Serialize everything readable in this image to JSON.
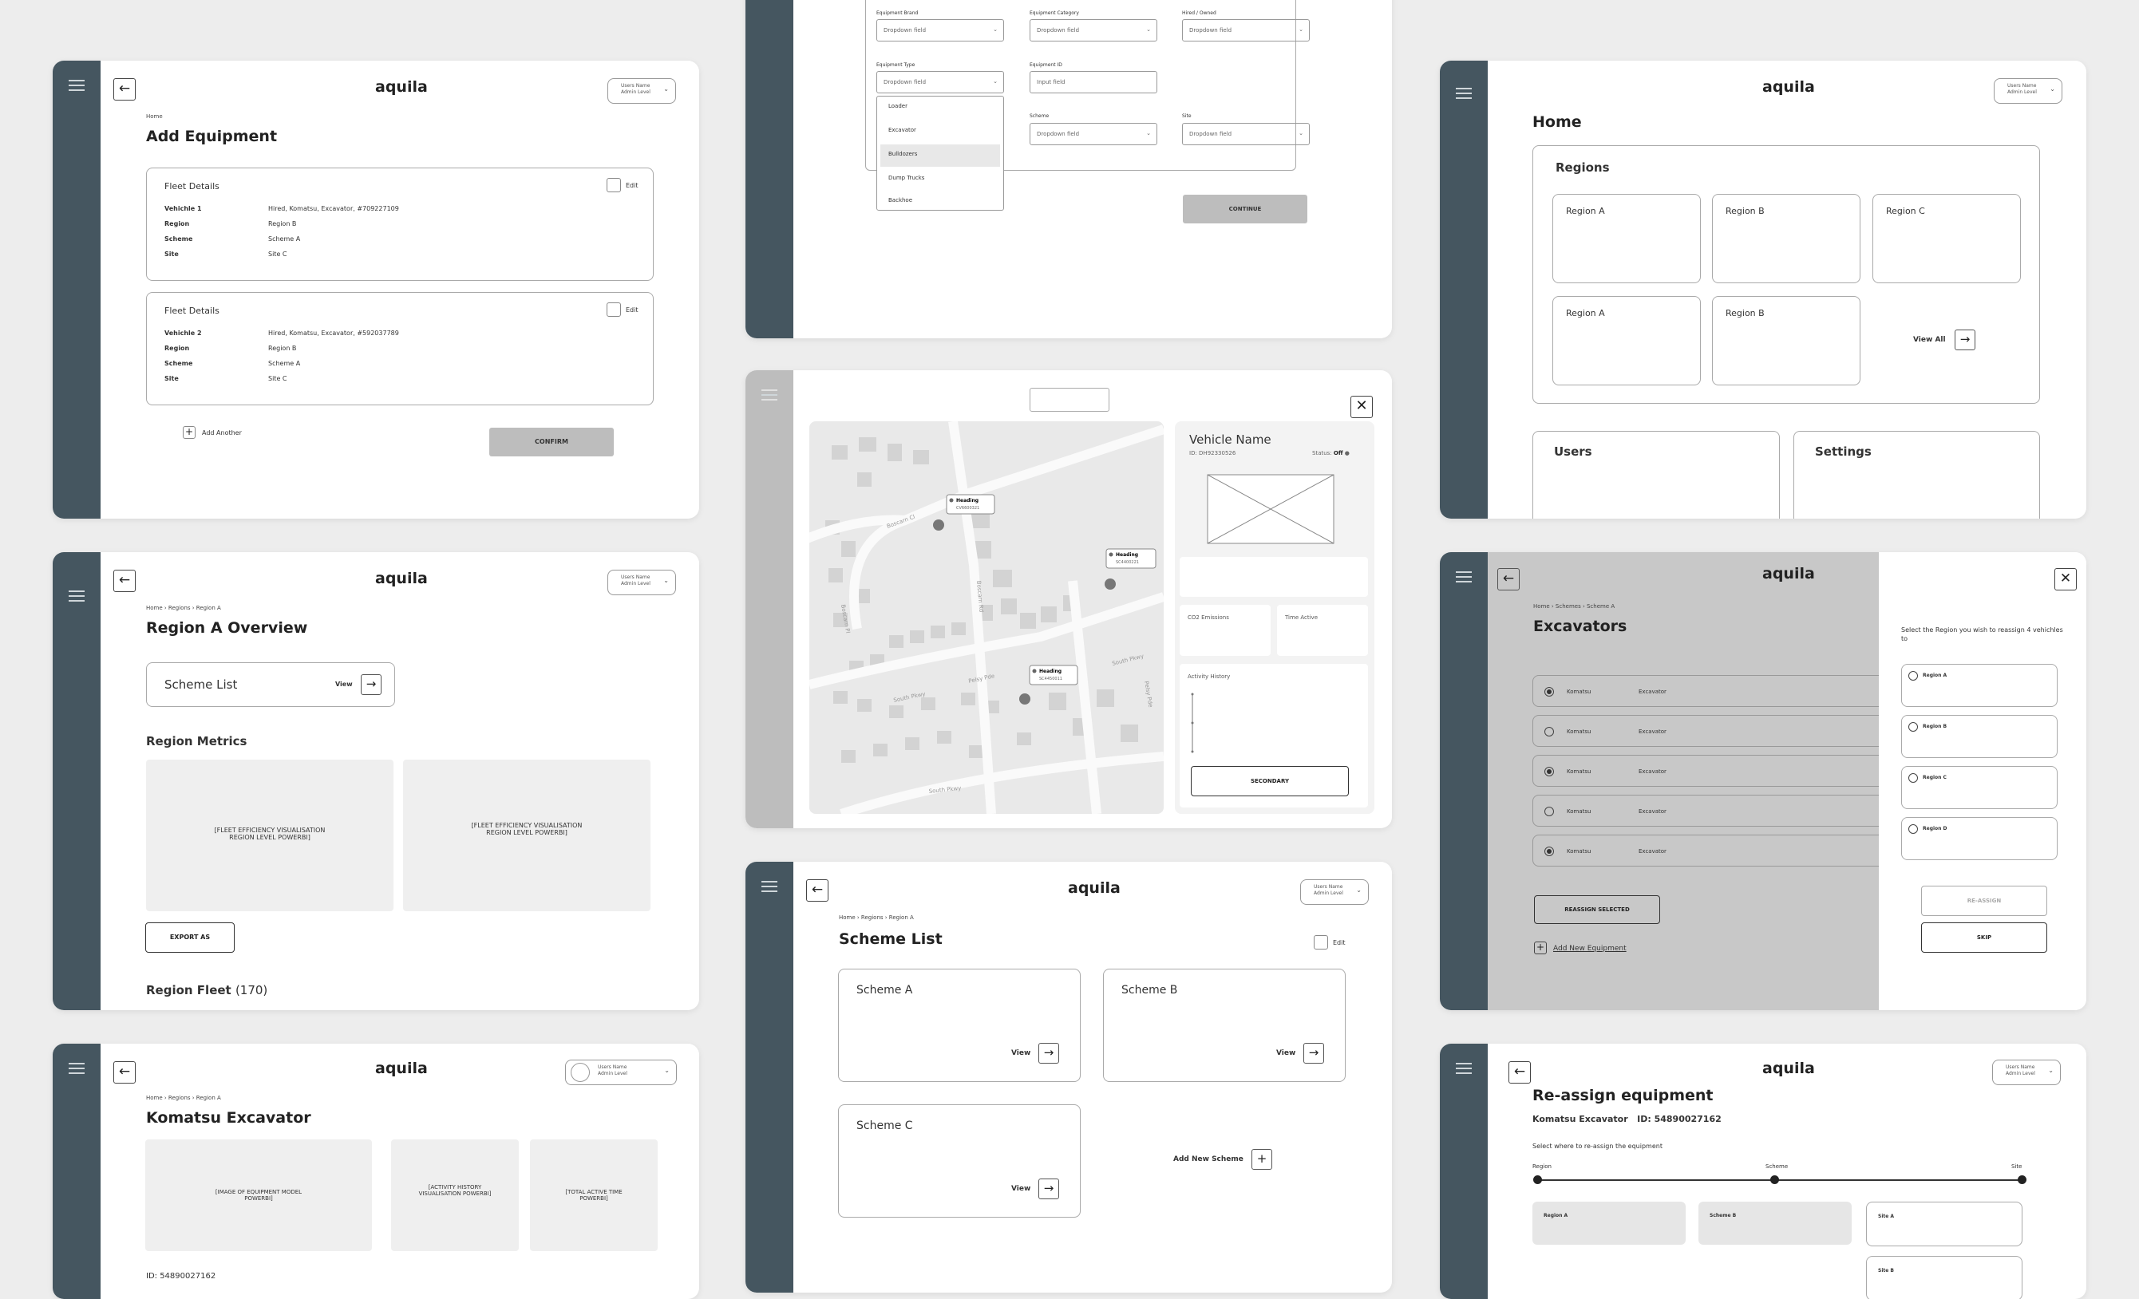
{
  "brand": "aquila",
  "user": {
    "name": "Users Name",
    "level": "Admin Level"
  },
  "c1": {
    "crumb": "Home",
    "title": "Add Equipment",
    "edit": "Edit",
    "fleets": [
      {
        "title": "Fleet Details",
        "rows": [
          [
            "Vehichle 1",
            "Hired, Komatsu, Excavator, #709227109"
          ],
          [
            "Region",
            "Region B"
          ],
          [
            "Scheme",
            "Scheme A"
          ],
          [
            "Site",
            "Site C"
          ]
        ]
      },
      {
        "title": "Fleet Details",
        "rows": [
          [
            "Vehichle 2",
            "Hired, Komatsu, Excavator, #592037789"
          ],
          [
            "Region",
            "Region B"
          ],
          [
            "Scheme",
            "Scheme A"
          ],
          [
            "Site",
            "Site C"
          ]
        ]
      }
    ],
    "add": "Add Another",
    "confirm": "CONFIRM"
  },
  "c2": {
    "brand_l": "Equipment Brand",
    "cat_l": "Equipment Category",
    "hired_l": "Hired / Owned",
    "type_l": "Equipment Type",
    "id_l": "Equipment ID",
    "scheme_l": "Scheme",
    "site_l": "Site",
    "dropdown": "Dropdown field",
    "input": "Input field",
    "options": [
      "Loader",
      "Excavator",
      "Bulldozers",
      "Dump Trucks",
      "Backhoe"
    ],
    "continue": "CONTINUE"
  },
  "c3": {
    "title": "Home",
    "regions_h": "Regions",
    "regions": [
      "Region A",
      "Region B",
      "Region C",
      "Region A",
      "Region B"
    ],
    "view_all": "View All",
    "users": "Users",
    "settings": "Settings"
  },
  "c4": {
    "crumbs": [
      "Home",
      "Regions",
      "Region A"
    ],
    "title": "Region A Overview",
    "scheme_list": "Scheme List",
    "view": "View",
    "metrics": "Region Metrics",
    "viz1": "[FLEET EFFICIENCY VISUALISATION REGION LEVEL POWERBI]",
    "viz2": "[FLEET EFFICIENCY VISUALISATION REGION LEVEL POWERBI]",
    "export": "EXPORT AS",
    "fleet": "Region Fleet",
    "fleet_count": "(170)"
  },
  "c5": {
    "vehicle": "Vehicle Name",
    "id": "ID: DH92330526",
    "status_l": "Status:",
    "status": "Off",
    "co2": "CO2 Emissions",
    "time": "Time Active",
    "history": "Activity History",
    "secondary": "SECONDARY",
    "streets": [
      "Boscarn Cl",
      "Boscarn Rd",
      "Boscarn Pl",
      "Pelsy Pde",
      "South Pkwy",
      "South Pkwy",
      "South Pkwy",
      "Pelsy Pde"
    ],
    "pins": [
      {
        "h": "Heading",
        "id": "CV6600321"
      },
      {
        "h": "Heading",
        "id": "SC4400221"
      },
      {
        "h": "Heading",
        "id": "SC4450011"
      }
    ]
  },
  "c6": {
    "crumbs": [
      "Home",
      "Schemes",
      "Scheme A"
    ],
    "title": "Excavators",
    "rows": [
      {
        "b": "Komatsu",
        "t": "Excavator",
        "on": true
      },
      {
        "b": "Komatsu",
        "t": "Excavator",
        "on": false
      },
      {
        "b": "Komatsu",
        "t": "Excavator",
        "on": true
      },
      {
        "b": "Komatsu",
        "t": "Excavator",
        "on": false
      },
      {
        "b": "Komatsu",
        "t": "Excavator",
        "on": true
      }
    ],
    "reassign_sel": "REASSIGN SELECTED",
    "add": "Add New Equipment",
    "prompt": "Select the Region you wish to reassign 4 vehichles to",
    "regions": [
      "Region A",
      "Region B",
      "Region C",
      "Region D"
    ],
    "reassign": "RE-ASSIGN",
    "skip": "SKIP"
  },
  "c7": {
    "crumbs": [
      "Home",
      "Regions",
      "Region A"
    ],
    "title": "Scheme List",
    "edit": "Edit",
    "schemes": [
      "Scheme A",
      "Scheme B",
      "Scheme C"
    ],
    "view": "View",
    "add": "Add New Scheme"
  },
  "c8": {
    "crumbs": [
      "Home",
      "Regions",
      "Region A"
    ],
    "title": "Komatsu Excavator",
    "img": "[IMAGE OF EQUIPMENT MODEL POWERBI]",
    "act": "[ACTIVITY HISTORY VISUALISATION POWERBI]",
    "tot": "[TOTAL ACTIVE TIME POWERBI]",
    "id": "ID: 54890027162"
  },
  "c9": {
    "title": "Re-assign equipment",
    "sub": "Komatsu Excavator",
    "id": "ID: 54890027162",
    "prompt": "Select where to re-assign the equipment",
    "steps": [
      "Region",
      "Scheme",
      "Site"
    ],
    "opts": [
      "Region A",
      "Scheme B",
      "Site A",
      "Site B"
    ]
  }
}
